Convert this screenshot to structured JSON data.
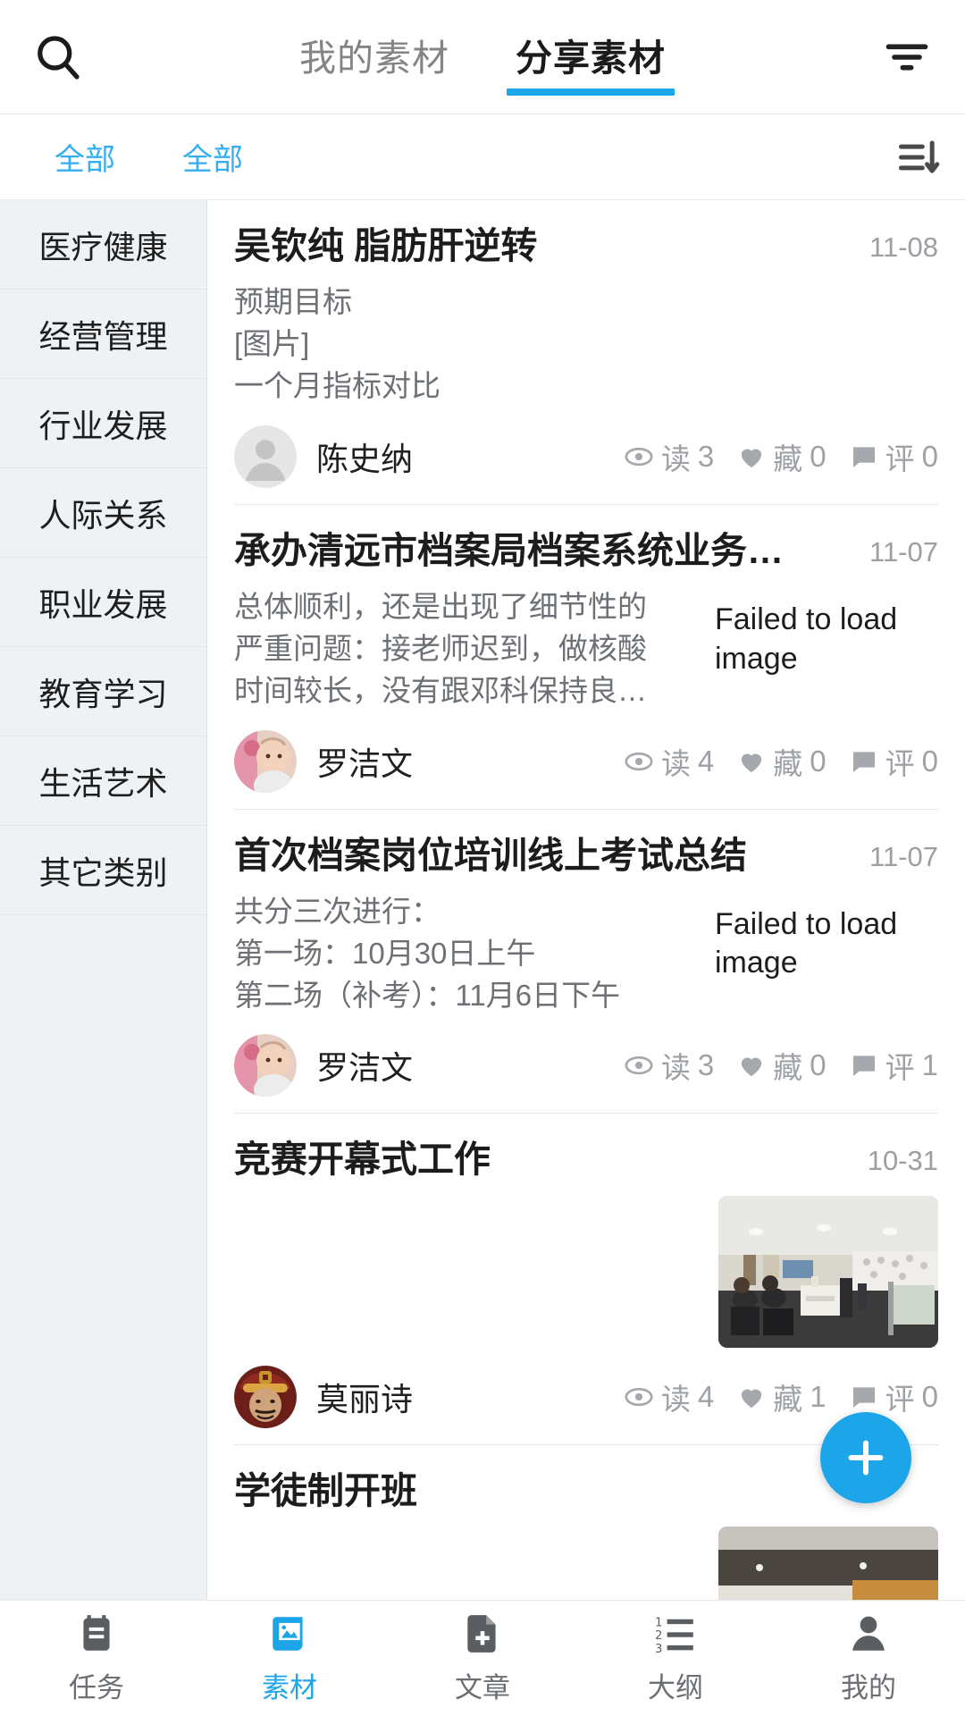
{
  "theme": {
    "accent": "#1CA5E8",
    "accent_text": "#33AEF2",
    "muted": "#9ea2a6"
  },
  "header": {
    "search_icon": "search-icon",
    "filter_icon": "filter-icon",
    "tabs": [
      {
        "label": "我的素材",
        "active": false
      },
      {
        "label": "分享素材",
        "active": true
      }
    ]
  },
  "filterbar": {
    "category_filter": "全部",
    "type_filter": "全部",
    "sort_icon": "sort-descending-icon"
  },
  "sidebar": {
    "items": [
      {
        "label": "医疗健康"
      },
      {
        "label": "经营管理"
      },
      {
        "label": "行业发展"
      },
      {
        "label": "人际关系"
      },
      {
        "label": "职业发展"
      },
      {
        "label": "教育学习"
      },
      {
        "label": "生活艺术"
      },
      {
        "label": "其它类别"
      }
    ]
  },
  "list": {
    "cards": [
      {
        "title": "吴钦纯 脂肪肝逆转",
        "date": "11-08",
        "excerpt_lines": [
          "预期目标",
          "[图片]",
          "一个月指标对比"
        ],
        "thumb": {
          "type": "none"
        },
        "author": "陈史纳",
        "avatar": "default-person-avatar",
        "stats": {
          "read_label": "读",
          "read": "3",
          "fav_label": "藏",
          "fav": "0",
          "comment_label": "评",
          "comment": "0"
        }
      },
      {
        "title": "承办清远市档案局档案系统业务…",
        "date": "11-07",
        "excerpt_lines": [
          "总体顺利，还是出现了细节性的",
          "严重问题：接老师迟到，做核酸",
          "时间较长，没有跟邓科保持良…"
        ],
        "thumb": {
          "type": "failed",
          "text": "Failed to load image"
        },
        "author": "罗洁文",
        "avatar": "baby-photo-avatar",
        "stats": {
          "read_label": "读",
          "read": "4",
          "fav_label": "藏",
          "fav": "0",
          "comment_label": "评",
          "comment": "0"
        }
      },
      {
        "title": "首次档案岗位培训线上考试总结",
        "date": "11-07",
        "excerpt_lines": [
          "共分三次进行：",
          "第一场：10月30日上午",
          "第二场（补考）：11月6日下午"
        ],
        "thumb": {
          "type": "failed",
          "text": "Failed to load image"
        },
        "author": "罗洁文",
        "avatar": "baby-photo-avatar",
        "stats": {
          "read_label": "读",
          "read": "3",
          "fav_label": "藏",
          "fav": "0",
          "comment_label": "评",
          "comment": "1"
        }
      },
      {
        "title": "竞赛开幕式工作",
        "date": "10-31",
        "excerpt_lines": [],
        "thumb": {
          "type": "photo",
          "alt": "office-meeting-room-photo"
        },
        "author": "莫丽诗",
        "avatar": "emperor-portrait-avatar",
        "stats": {
          "read_label": "读",
          "read": "4",
          "fav_label": "藏",
          "fav": "1",
          "comment_label": "评",
          "comment": "0"
        }
      },
      {
        "title": "学徒制开班",
        "date": "",
        "excerpt_lines": [],
        "thumb": {
          "type": "photo-partial",
          "alt": "workshop-photo"
        },
        "author": "",
        "avatar": "",
        "stats": null
      }
    ]
  },
  "fab": {
    "icon": "plus-icon",
    "label": "+"
  },
  "bottomnav": {
    "items": [
      {
        "label": "任务",
        "icon": "clipboard-icon",
        "active": false
      },
      {
        "label": "素材",
        "icon": "image-material-icon",
        "active": true
      },
      {
        "label": "文章",
        "icon": "document-add-icon",
        "active": false
      },
      {
        "label": "大纲",
        "icon": "numbered-list-icon",
        "active": false
      },
      {
        "label": "我的",
        "icon": "person-icon",
        "active": false
      }
    ]
  }
}
